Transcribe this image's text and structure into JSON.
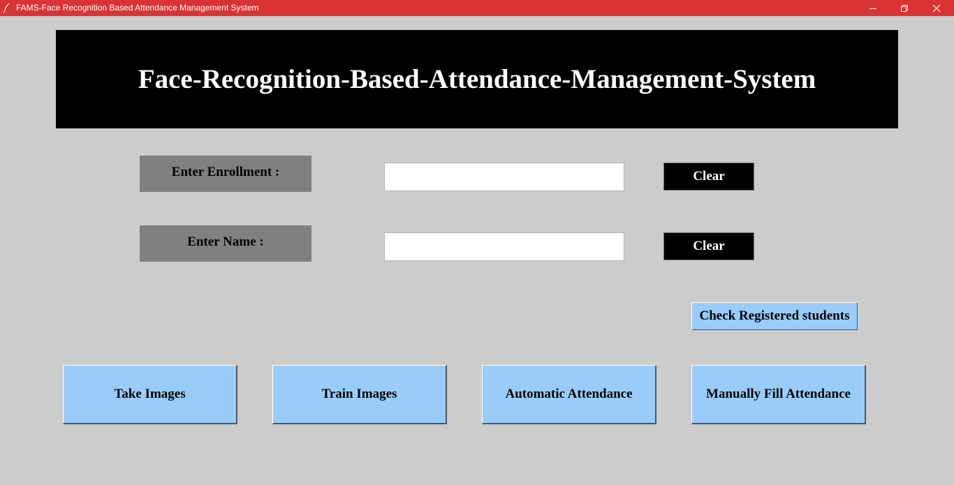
{
  "window": {
    "title": "FAMS-Face Recognition Based Attendance Management System",
    "icon": "feather-icon",
    "titlebar_color": "#d93434",
    "controls": [
      "minimize-icon",
      "restore-icon",
      "close-icon"
    ]
  },
  "header": {
    "title": "Face-Recognition-Based-Attendance-Management-System"
  },
  "form": {
    "enrollment": {
      "label": "Enter Enrollment :",
      "value": "",
      "clear_label": "Clear"
    },
    "name": {
      "label": "Enter Name :",
      "value": "",
      "clear_label": "Clear"
    }
  },
  "check_registered_label": "Check Registered students",
  "actions": {
    "take_images": "Take Images",
    "train_images": "Train Images",
    "automatic_attendance": "Automatic Attendance",
    "manual_attendance": "Manually Fill Attendance"
  },
  "colors": {
    "background": "#cccccc",
    "button_blue": "#99ccf8",
    "label_gray": "#808080",
    "banner": "#000000"
  }
}
